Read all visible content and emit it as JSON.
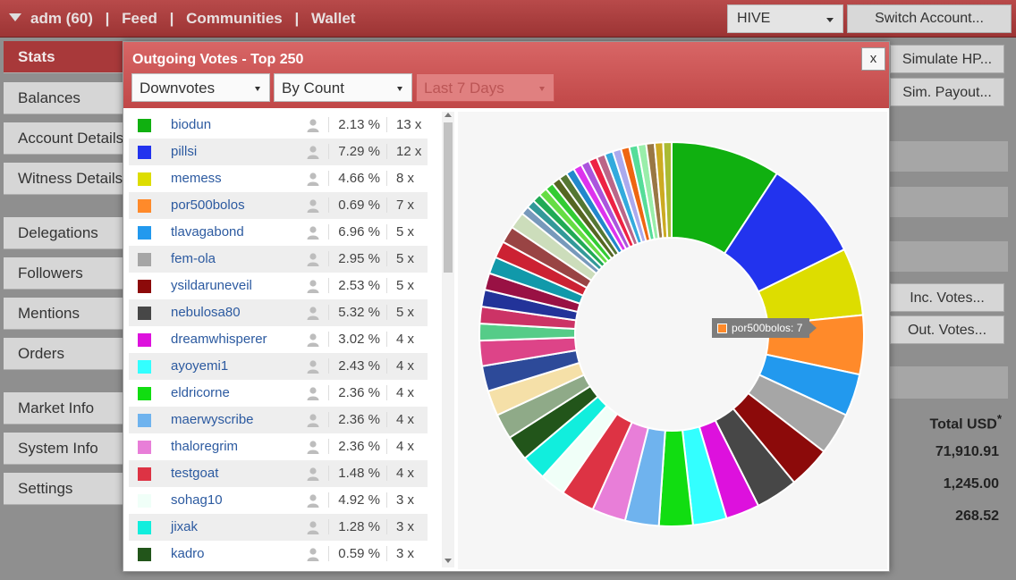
{
  "topbar": {
    "account": "adm (60)",
    "nav": [
      "Feed",
      "Communities",
      "Wallet"
    ],
    "separator": "|",
    "currency": "HIVE",
    "switch_label": "Switch Account..."
  },
  "sidebar": {
    "items": [
      {
        "label": "Stats",
        "active": true
      },
      {
        "label": "Balances"
      },
      {
        "label": "Account Details"
      },
      {
        "label": "Witness Details"
      },
      {
        "label": "Delegations"
      },
      {
        "label": "Followers"
      },
      {
        "label": "Mentions"
      },
      {
        "label": "Orders"
      },
      {
        "label": "Market Info"
      },
      {
        "label": "System Info"
      },
      {
        "label": "Settings"
      }
    ]
  },
  "right": {
    "simulate_hp": "Simulate HP...",
    "sim_payout": "Sim. Payout...",
    "inc_votes": "Inc. Votes...",
    "out_votes": "Out. Votes...",
    "total_usd_label": "Total USD",
    "total_usd_mark": "*",
    "values": [
      "71,910.91",
      "1,245.00",
      "268.52"
    ]
  },
  "modal": {
    "title": "Outgoing Votes - Top 250",
    "close": "x",
    "filter_type": "Downvotes",
    "sort": "By Count",
    "period": "Last 7 Days",
    "tooltip": "por500bolos: 7"
  },
  "rows": [
    {
      "name": "biodun",
      "pct": "2.13 %",
      "count": "13 x",
      "color": "#10b010"
    },
    {
      "name": "pillsi",
      "pct": "7.29 %",
      "count": "12 x",
      "color": "#2233ee"
    },
    {
      "name": "memess",
      "pct": "4.66 %",
      "count": "8 x",
      "color": "#dddd00"
    },
    {
      "name": "por500bolos",
      "pct": "0.69 %",
      "count": "7 x",
      "color": "#ff8a2a"
    },
    {
      "name": "tlavagabond",
      "pct": "6.96 %",
      "count": "5 x",
      "color": "#2299ee"
    },
    {
      "name": "fem-ola",
      "pct": "2.95 %",
      "count": "5 x",
      "color": "#a6a6a6"
    },
    {
      "name": "ysildaruneveil",
      "pct": "2.53 %",
      "count": "5 x",
      "color": "#8c0a0a"
    },
    {
      "name": "nebulosa80",
      "pct": "5.32 %",
      "count": "5 x",
      "color": "#474747"
    },
    {
      "name": "dreamwhisperer",
      "pct": "3.02 %",
      "count": "4 x",
      "color": "#dd11dd"
    },
    {
      "name": "ayoyemi1",
      "pct": "2.43 %",
      "count": "4 x",
      "color": "#33ffff"
    },
    {
      "name": "eldricorne",
      "pct": "2.36 %",
      "count": "4 x",
      "color": "#11dd11"
    },
    {
      "name": "maerwyscribe",
      "pct": "2.36 %",
      "count": "4 x",
      "color": "#6fb3ee"
    },
    {
      "name": "thaloregrim",
      "pct": "2.36 %",
      "count": "4 x",
      "color": "#e87ed8"
    },
    {
      "name": "testgoat",
      "pct": "1.48 %",
      "count": "4 x",
      "color": "#dd3344"
    },
    {
      "name": "sohag10",
      "pct": "4.92 %",
      "count": "3 x",
      "color": "#f0fff8"
    },
    {
      "name": "jixak",
      "pct": "1.28 %",
      "count": "3 x",
      "color": "#11eedd"
    },
    {
      "name": "kadro",
      "pct": "0.59 %",
      "count": "3 x",
      "color": "#22551a"
    }
  ],
  "chart_data": {
    "type": "pie",
    "donut": true,
    "series": [
      {
        "name": "biodun",
        "value": 13,
        "color": "#10b010"
      },
      {
        "name": "pillsi",
        "value": 12,
        "color": "#2233ee"
      },
      {
        "name": "memess",
        "value": 8,
        "color": "#dddd00"
      },
      {
        "name": "por500bolos",
        "value": 7,
        "color": "#ff8a2a"
      },
      {
        "name": "tlavagabond",
        "value": 5,
        "color": "#2299ee"
      },
      {
        "name": "fem-ola",
        "value": 5,
        "color": "#a6a6a6"
      },
      {
        "name": "ysildaruneveil",
        "value": 5,
        "color": "#8c0a0a"
      },
      {
        "name": "nebulosa80",
        "value": 5,
        "color": "#474747"
      },
      {
        "name": "dreamwhisperer",
        "value": 4,
        "color": "#dd11dd"
      },
      {
        "name": "ayoyemi1",
        "value": 4,
        "color": "#33ffff"
      },
      {
        "name": "eldricorne",
        "value": 4,
        "color": "#11dd11"
      },
      {
        "name": "maerwyscribe",
        "value": 4,
        "color": "#6fb3ee"
      },
      {
        "name": "thaloregrim",
        "value": 4,
        "color": "#e87ed8"
      },
      {
        "name": "testgoat",
        "value": 4,
        "color": "#dd3344"
      },
      {
        "name": "sohag10",
        "value": 3,
        "color": "#f0fff8"
      },
      {
        "name": "jixak",
        "value": 3,
        "color": "#11eedd"
      },
      {
        "name": "kadro",
        "value": 3,
        "color": "#22551a"
      },
      {
        "name": "",
        "value": 3,
        "color": "#8faa88"
      },
      {
        "name": "",
        "value": 3,
        "color": "#f5e0a8"
      },
      {
        "name": "",
        "value": 3,
        "color": "#2d4a99"
      },
      {
        "name": "",
        "value": 3,
        "color": "#dd4488"
      },
      {
        "name": "",
        "value": 2,
        "color": "#55cc88"
      },
      {
        "name": "",
        "value": 2,
        "color": "#cc3366"
      },
      {
        "name": "",
        "value": 2,
        "color": "#223399"
      },
      {
        "name": "",
        "value": 2,
        "color": "#991144"
      },
      {
        "name": "",
        "value": 2,
        "color": "#1199aa"
      },
      {
        "name": "",
        "value": 2,
        "color": "#cc2233"
      },
      {
        "name": "",
        "value": 2,
        "color": "#994444"
      },
      {
        "name": "",
        "value": 2,
        "color": "#ccddbb"
      },
      {
        "name": "",
        "value": 1,
        "color": "#7799bb"
      },
      {
        "name": "",
        "value": 1,
        "color": "#339999"
      },
      {
        "name": "",
        "value": 1,
        "color": "#22aa55"
      },
      {
        "name": "",
        "value": 1,
        "color": "#66dd44"
      },
      {
        "name": "",
        "value": 1,
        "color": "#33cc33"
      },
      {
        "name": "",
        "value": 1,
        "color": "#556622"
      },
      {
        "name": "",
        "value": 1,
        "color": "#557733"
      },
      {
        "name": "",
        "value": 1,
        "color": "#2288cc"
      },
      {
        "name": "",
        "value": 1,
        "color": "#dd33ee"
      },
      {
        "name": "",
        "value": 1,
        "color": "#aa55dd"
      },
      {
        "name": "",
        "value": 1,
        "color": "#ee2244"
      },
      {
        "name": "",
        "value": 1,
        "color": "#bb6688"
      },
      {
        "name": "",
        "value": 1,
        "color": "#33aadd"
      },
      {
        "name": "",
        "value": 1,
        "color": "#aaaaee"
      },
      {
        "name": "",
        "value": 1,
        "color": "#ee6611"
      },
      {
        "name": "",
        "value": 1,
        "color": "#55dd99"
      },
      {
        "name": "",
        "value": 1,
        "color": "#99eeaa"
      },
      {
        "name": "",
        "value": 1,
        "color": "#997744"
      },
      {
        "name": "",
        "value": 1,
        "color": "#ccaa22"
      },
      {
        "name": "",
        "value": 1,
        "color": "#aabb33"
      }
    ]
  }
}
